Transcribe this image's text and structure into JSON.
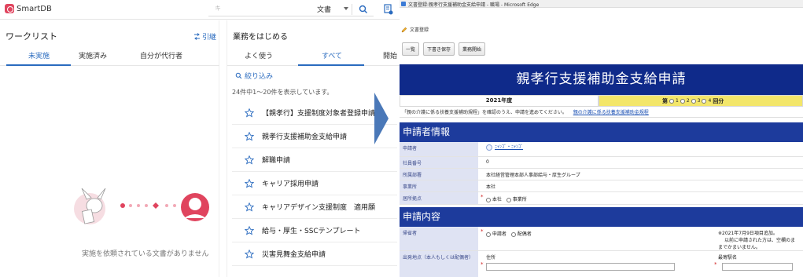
{
  "app": {
    "logo_text": "SmartDB",
    "search": {
      "placeholder": "キ",
      "category": "文書"
    }
  },
  "worklist": {
    "title": "ワークリスト",
    "link_label": "引継",
    "tabs": [
      "未実施",
      "実施済み",
      "自分が代行者"
    ],
    "active_tab": 0,
    "empty_message": "実施を依頼されている文書がありません"
  },
  "business": {
    "title": "業務をはじめる",
    "tabs": [
      "よく使う",
      "すべて",
      "開始"
    ],
    "active_tab": 1,
    "filter_label": "絞り込み",
    "count_text": "24件中1～20件を表示しています。",
    "items": [
      "【親孝行】支援制度対象者登録申請",
      "親孝行支援補助金支給申請",
      "解職申請",
      "キャリア採用申請",
      "キャリアデザイン支援制度　適用願",
      "給与・厚生・SSCテンプレート",
      "災害見舞金支給申請"
    ]
  },
  "edge": {
    "window_title": "文書登録:親孝行支援補助金支給申請 - 職場 - Microsoft Edge",
    "form_header": "文書登録",
    "buttons": [
      "一覧",
      "下書き保存",
      "業務開始"
    ],
    "banner_title": "親孝行支援補助金支給申請",
    "fiscal_year": "2021年度",
    "round_prefix": "第",
    "round_options": [
      "1",
      "2",
      "3",
      "4"
    ],
    "round_suffix": "回分",
    "note_text": "「親の介護に係る扶養支援補助規程」を確認のうえ、申請を進めてください。",
    "note_link": "親の介護に係る扶養支援補助金規程",
    "section_applicant": "申請者情報",
    "applicant_rows": [
      {
        "label": "申請者",
        "value": ""
      },
      {
        "label": "社員番号",
        "value": "0"
      },
      {
        "label": "所属部署",
        "value": "本社経営管理本部人事部給与・厚生グループ"
      },
      {
        "label": "事業所",
        "value": "本社"
      },
      {
        "label": "居所拠点",
        "options": [
          "本社",
          "事業所"
        ]
      }
    ],
    "user_name": "ﾆｬﾝｺﾞ・ﾆｬﾝｺﾞ",
    "section_content": "申請内容",
    "content_rows": [
      {
        "label": "帰省者",
        "options": [
          "申請者",
          "配偶者"
        ],
        "note1": "※2021年7月9日項目追加。",
        "note2": "以前に申請された方は、空欄のま",
        "note3": "までかまいません。"
      },
      {
        "label": "出発地点（本人もしくは配偶者）",
        "field1": "住所",
        "field2": "最寄駅名"
      }
    ]
  },
  "colors": {
    "brand": "#e0445e",
    "link": "#2a6bbf",
    "banner": "#0f2a8a",
    "section": "#1d3b9c",
    "year_highlight": "#f3e66a",
    "label_bg": "#dfe3f3",
    "arrow": "#4a78b8"
  }
}
